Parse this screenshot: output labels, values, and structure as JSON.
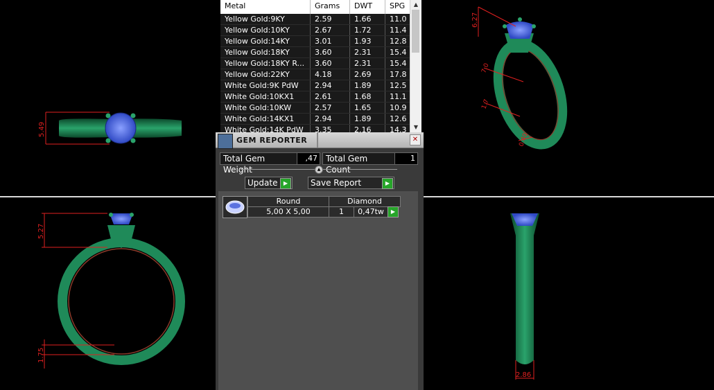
{
  "metal_table": {
    "headers": [
      "Metal",
      "Grams",
      "DWT",
      "SPG"
    ],
    "rows": [
      [
        "Yellow Gold:9KY",
        "2.59",
        "1.66",
        "11.0"
      ],
      [
        "Yellow Gold:10KY",
        "2.67",
        "1.72",
        "11.4"
      ],
      [
        "Yellow Gold:14KY",
        "3.01",
        "1.93",
        "12.8"
      ],
      [
        "Yellow Gold:18KY",
        "3.60",
        "2.31",
        "15.4"
      ],
      [
        "Yellow Gold:18KY R...",
        "3.60",
        "2.31",
        "15.4"
      ],
      [
        "Yellow Gold:22KY",
        "4.18",
        "2.69",
        "17.8"
      ],
      [
        "White Gold:9K PdW",
        "2.94",
        "1.89",
        "12.5"
      ],
      [
        "White Gold:10KX1",
        "2.61",
        "1.68",
        "11.1"
      ],
      [
        "White Gold:10KW",
        "2.57",
        "1.65",
        "10.9"
      ],
      [
        "White Gold:14KX1",
        "2.94",
        "1.89",
        "12.6"
      ],
      [
        "White Gold:14K PdW",
        "3.35",
        "2.16",
        "14.3"
      ]
    ]
  },
  "gem_reporter": {
    "title": "GEM REPORTER",
    "close": "✕",
    "total_weight_label": "Total Gem Weight",
    "total_weight_value": ",47",
    "total_count_label": "Total Gem Count",
    "total_count_value": "1",
    "update_label": "Update",
    "save_report_label": "Save Report",
    "gem": {
      "shape": "Round",
      "size": "5,00 X 5,00",
      "material": "Diamond",
      "count": "1",
      "weight": "0,47tw"
    }
  },
  "dimensions": {
    "top_view_width": "5.49",
    "front_view_height": "5.27",
    "front_view_shank": "1.75",
    "side_view_width": "2.86",
    "iso_view_height": "6.27",
    "iso_view_a": "7.0",
    "iso_view_b": "1.7",
    "iso_view_c": "0.40"
  },
  "colors": {
    "ring": "#1e7d4f",
    "gem": "#4a68d8",
    "dimension": "#e02020"
  }
}
